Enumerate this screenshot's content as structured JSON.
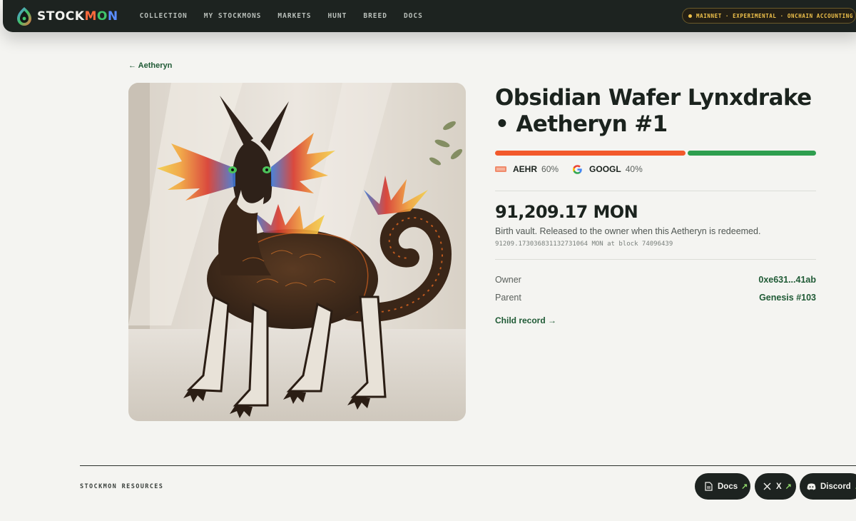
{
  "nav": {
    "brand": {
      "part1": "STOCK",
      "m": "M",
      "o": "O",
      "n": "N"
    },
    "links": [
      "COLLECTION",
      "MY STOCKMONS",
      "MARKETS",
      "HUNT",
      "BREED",
      "DOCS"
    ],
    "network_badge": "MAINNET · EXPERIMENTAL · ONCHAIN ACCOUNTING"
  },
  "breadcrumb": {
    "back_label": "← Aetheryn"
  },
  "creature": {
    "title": "Obsidian Wafer Lynxdrake • Aetheryn #1",
    "image_alt": "Obsidian Wafer Lynxdrake artwork"
  },
  "allocation": [
    {
      "ticker": "AEHR",
      "pct_label": "60%",
      "fraction": 0.6,
      "color": "#f2592b",
      "icon": "aehr-logo-icon"
    },
    {
      "ticker": "GOOGL",
      "pct_label": "40%",
      "fraction": 0.4,
      "color": "#2e9e4f",
      "icon": "google-logo-icon"
    }
  ],
  "vault": {
    "amount": "91,209.17 MON",
    "description": "Birth vault. Released to the owner when this Aetheryn is redeemed.",
    "raw": "91209.173036831132731064 MON at block 74096439"
  },
  "details": [
    {
      "key": "Owner",
      "value": "0xe631...41ab"
    },
    {
      "key": "Parent",
      "value": "Genesis #103"
    }
  ],
  "child_link": "Child record →",
  "footer": {
    "resources_label": "STOCKMON RESOURCES",
    "buttons": [
      {
        "label": "Docs",
        "arrow": "↗",
        "icon": "document-icon"
      },
      {
        "label": "X",
        "arrow": "↗",
        "icon": "x-logo-icon"
      },
      {
        "label": "Discord",
        "arrow": "↗",
        "icon": "discord-icon"
      }
    ]
  },
  "colors": {
    "accent_green": "#1f5a35",
    "nav_bg": "#1d2320",
    "badge_gold": "#f0c24b"
  }
}
